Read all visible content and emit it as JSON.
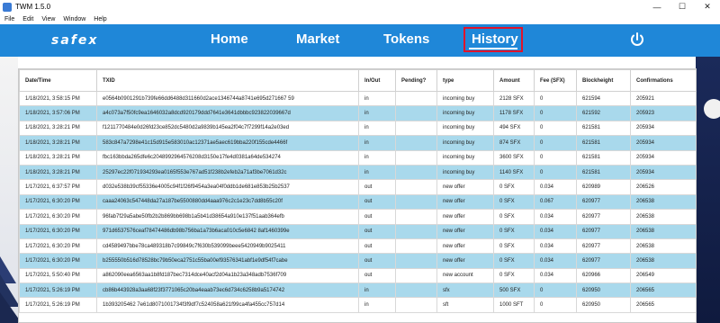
{
  "window": {
    "title": "TWM 1.5.0",
    "controls": [
      "—",
      "☐",
      "✕"
    ]
  },
  "menu": [
    "File",
    "Edit",
    "View",
    "Window",
    "Help"
  ],
  "nav": {
    "logo": "safex",
    "home": "Home",
    "market": "Market",
    "tokens": "Tokens",
    "history": "History",
    "active": "History"
  },
  "colors": {
    "nav_bg": "#1f87d8",
    "active_border": "#e0142b",
    "row_highlight": "#a9d9ec"
  },
  "table": {
    "headers": [
      "Date/Time",
      "TXID",
      "In/Out",
      "Pending?",
      "type",
      "Amount",
      "Fee (SFX)",
      "Blockheight",
      "Confirmations"
    ],
    "rows": [
      [
        "1/18/2021, 3:58:15 PM",
        "e0564b0901291b739fe66dd6488d311660d2ace1346744a8741e695d271667 59",
        "in",
        "",
        "incoming buy",
        "2128 SFX",
        "0",
        "621594",
        "205921"
      ],
      [
        "1/18/2021, 3:57:06 PM",
        "a4c073a7f50fc9ea1646032a8dcd920179ddd7641e3641dbbbc923822039667d",
        "in",
        "",
        "incoming buy",
        "1178 SFX",
        "0",
        "621592",
        "205923"
      ],
      [
        "1/18/2021, 3:28:21 PM",
        "f1211770484e0d26fd23ce852dc5480d2a9839b145ea2f04c7f7299f14a2e03ed",
        "in",
        "",
        "incoming buy",
        "494 SFX",
        "0",
        "621581",
        "205934"
      ],
      [
        "1/18/2021, 3:28:21 PM",
        "583c847a7298e41c15d915e583010ac12371ae5aec619bba220f155cde4466f",
        "in",
        "",
        "incoming buy",
        "874 SFX",
        "0",
        "621581",
        "205934"
      ],
      [
        "1/18/2021, 3:28:21 PM",
        "fbc163bbda265dfe6c2048992964576208d3150e17fe4d0381a64de534274",
        "in",
        "",
        "incoming buy",
        "3600 SFX",
        "0",
        "621581",
        "205934"
      ],
      [
        "1/18/2021, 3:28:21 PM",
        "25297ec22f071934293ea0165f553e767ad51f238b2efeb2a71af3be7061d32c",
        "in",
        "",
        "incoming buy",
        "1140 SFX",
        "0",
        "621581",
        "205934"
      ],
      [
        "1/17/2021, 6:37:57 PM",
        "d032e538b39cf55336e4005c94f1f26f9454a3ea04f0ddb1de681e853b25b2537",
        "out",
        "",
        "new offer",
        "0 SFX",
        "0.034",
        "620989",
        "206526"
      ],
      [
        "1/17/2021, 6:30:20 PM",
        "caaa24063c547448da27a187be5500880dd4aaa976c2c1e23c7dd8b55c20f",
        "out",
        "",
        "new offer",
        "0 SFX",
        "0.067",
        "620977",
        "206538"
      ],
      [
        "1/17/2021, 6:30:20 PM",
        "96fab7f29a5abe50fb2b2b869bb698b1a5b41d38654a910e137f51aab364efb",
        "out",
        "",
        "new offer",
        "0 SFX",
        "0.034",
        "620977",
        "206538"
      ],
      [
        "1/17/2021, 6:30:20 PM",
        "971d6537576ceaf78474486db98b756ba1a73b6aca010c5e6842 8af1460399e",
        "out",
        "",
        "new offer",
        "0 SFX",
        "0.034",
        "620977",
        "206538"
      ],
      [
        "1/17/2021, 6:30:20 PM",
        "cd4589497bbe78ca489318b7c99849c7f630b539099beee5420949b9025411",
        "out",
        "",
        "new offer",
        "0 SFX",
        "0.034",
        "620977",
        "206538"
      ],
      [
        "1/17/2021, 6:30:20 PM",
        "b255550b516d78528bc79b50eca2751c55ba00ef93576341abf1e9df54f7cabe",
        "out",
        "",
        "new offer",
        "0 SFX",
        "0.034",
        "620977",
        "206538"
      ],
      [
        "1/17/2021, 5:50:40 PM",
        "a862090eea6563aa1b8fd187bec7314dce40acf2d04a1b23a348adb7536f709",
        "out",
        "",
        "new account",
        "0 SFX",
        "0.034",
        "620966",
        "206549"
      ],
      [
        "1/17/2021, 5:26:19 PM",
        "cb86b443928a3aa68f23f3771065c20ba4eaab73ec6d734c6258b9a5174742",
        "in",
        "",
        "sfx",
        "500 SFX",
        "0",
        "620950",
        "206565"
      ],
      [
        "1/17/2021, 5:26:19 PM",
        "1b393205462 7e61d8071001734f3f9df7c524058a621f99ca4fa455cc757d14",
        "in",
        "",
        "sft",
        "1000 SFT",
        "0",
        "620950",
        "206565"
      ]
    ]
  }
}
